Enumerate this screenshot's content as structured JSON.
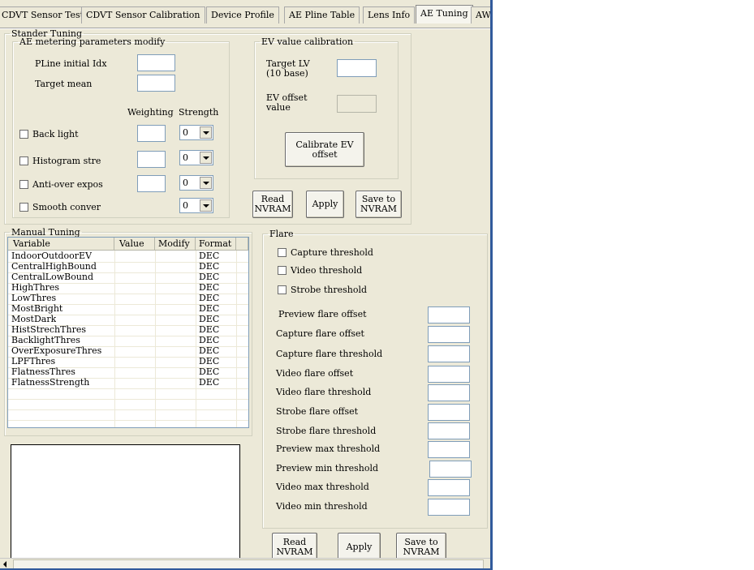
{
  "tabs": [
    "CDVT Sensor Test",
    "CDVT Sensor Calibration",
    "Device Profile",
    "AE Pline Table",
    "Lens Info",
    "AE Tuning",
    "AWB"
  ],
  "stander": {
    "title": "Stander Tuning",
    "metering": {
      "title": "AE metering parameters modify",
      "pline_label": "PLine initial Idx",
      "target_mean_label": "Target mean",
      "weighting_header": "Weighting",
      "strength_header": "Strength",
      "rows": [
        {
          "label": "Back light",
          "strength": "0"
        },
        {
          "label": "Histogram stre",
          "strength": "0"
        },
        {
          "label": "Anti-over expos",
          "strength": "0"
        },
        {
          "label": "Smooth conver",
          "strength": "0"
        }
      ]
    },
    "ev": {
      "title": "EV value calibration",
      "target_lv_label": "Target LV\n(10 base)",
      "ev_offset_label": "EV offset\nvalue",
      "calibrate_button": "Calibrate EV\noffset"
    },
    "read_button": "Read\nNVRAM",
    "apply_button": "Apply",
    "save_button": "Save to\nNVRAM"
  },
  "manual": {
    "title": "Manual Tuning",
    "columns": [
      "Variable",
      "Value",
      "Modify",
      "Format"
    ],
    "rows": [
      {
        "variable": "IndoorOutdoorEV",
        "format": "DEC"
      },
      {
        "variable": "CentralHighBound",
        "format": "DEC"
      },
      {
        "variable": "CentralLowBound",
        "format": "DEC"
      },
      {
        "variable": "HighThres",
        "format": "DEC"
      },
      {
        "variable": "LowThres",
        "format": "DEC"
      },
      {
        "variable": "MostBright",
        "format": "DEC"
      },
      {
        "variable": "MostDark",
        "format": "DEC"
      },
      {
        "variable": "HistStrechThres",
        "format": "DEC"
      },
      {
        "variable": "BacklightThres",
        "format": "DEC"
      },
      {
        "variable": "OverExposureThres",
        "format": "DEC"
      },
      {
        "variable": "LPFThres",
        "format": "DEC"
      },
      {
        "variable": "FlatnessThres",
        "format": "DEC"
      },
      {
        "variable": "FlatnessStrength",
        "format": "DEC"
      }
    ]
  },
  "flare": {
    "title": "Flare",
    "checkboxes": [
      "Capture threshold",
      "Video threshold",
      "Strobe threshold"
    ],
    "fields": [
      "Preview flare offset",
      "Capture flare offset",
      "Capture flare threshold",
      "Video flare offset",
      "Video flare threshold",
      "Strobe flare offset",
      "Strobe flare threshold",
      "Preview max threshold",
      "Preview min threshold",
      "Video max threshold",
      "Video min threshold"
    ],
    "read_button": "Read\nNVRAM",
    "apply_button": "Apply",
    "save_button": "Save to\nNVRAM"
  }
}
